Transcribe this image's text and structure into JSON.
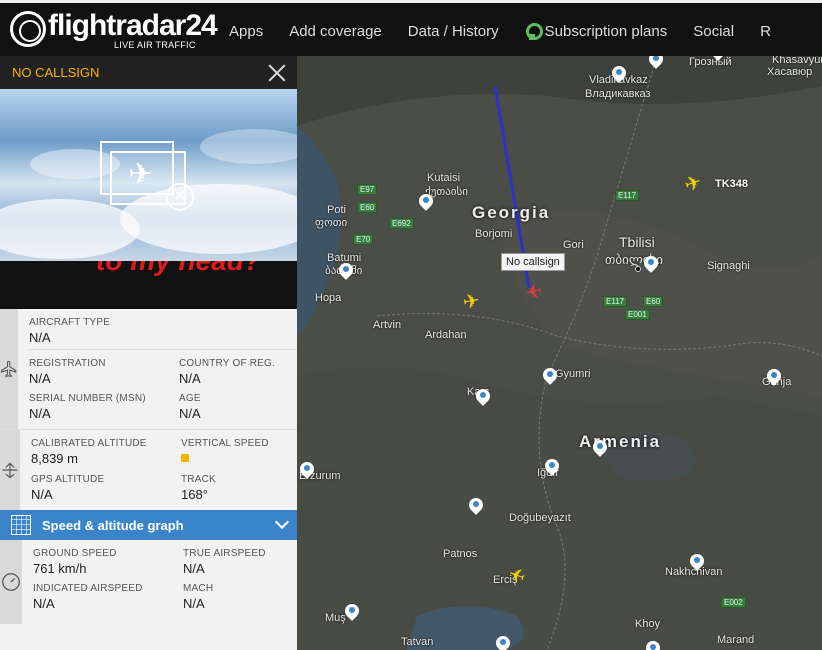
{
  "header": {
    "logo_text": "flightradar24",
    "logo_tagline": "LIVE AIR TRAFFIC",
    "nav": [
      "Apps",
      "Add coverage",
      "Data / History",
      "Subscription plans",
      "Social",
      "R"
    ]
  },
  "panel": {
    "callsign": "NO CALLSIGN",
    "banner_text": "to my head?",
    "aircraft_type": {
      "label": "AIRCRAFT TYPE",
      "value": "N/A"
    },
    "registration": {
      "label": "REGISTRATION",
      "value": "N/A"
    },
    "country": {
      "label": "COUNTRY OF REG.",
      "value": "N/A"
    },
    "msn": {
      "label": "SERIAL NUMBER (MSN)",
      "value": "N/A"
    },
    "age": {
      "label": "AGE",
      "value": "N/A"
    },
    "cal_alt": {
      "label": "CALIBRATED ALTITUDE",
      "value": "8,839 m"
    },
    "vert_speed": {
      "label": "VERTICAL SPEED",
      "value": ""
    },
    "gps_alt": {
      "label": "GPS ALTITUDE",
      "value": "N/A"
    },
    "track": {
      "label": "TRACK",
      "value": "168°"
    },
    "graph_label": "Speed & altitude graph",
    "ground_speed": {
      "label": "GROUND SPEED",
      "value": "761 km/h"
    },
    "true_airspeed": {
      "label": "TRUE AIRSPEED",
      "value": "N/A"
    },
    "ind_airspeed": {
      "label": "INDICATED AIRSPEED",
      "value": "N/A"
    },
    "mach": {
      "label": "MACH",
      "value": "N/A"
    }
  },
  "map": {
    "countries": [
      "Georgia",
      "Armenia"
    ],
    "cities": [
      "Vladikavkaz",
      "Владикавказ",
      "Грозный",
      "Khasavyur",
      "Хасавюр",
      "Kutaisi",
      "ქუთაისი",
      "Poti",
      "ფოთი",
      "Borjomi",
      "Gori",
      "Tbilisi",
      "თბილისი",
      "Batumi",
      "ბათუმი",
      "Signaghi",
      "Hopa",
      "Artvin",
      "Ardahan",
      "Gyumri",
      "Kars",
      "Ganja",
      "Iğdır",
      "Erzurum",
      "Doğubeyazıt",
      "Patnos",
      "Erciş",
      "Nakhchivan",
      "Muş",
      "Tatvan",
      "Khoy",
      "Marand"
    ],
    "roads": [
      "E97",
      "E60",
      "E70",
      "E692",
      "E117",
      "E117",
      "E60",
      "E001",
      "E002"
    ],
    "tooltip": "No callsign",
    "flight_label": "TK348"
  }
}
